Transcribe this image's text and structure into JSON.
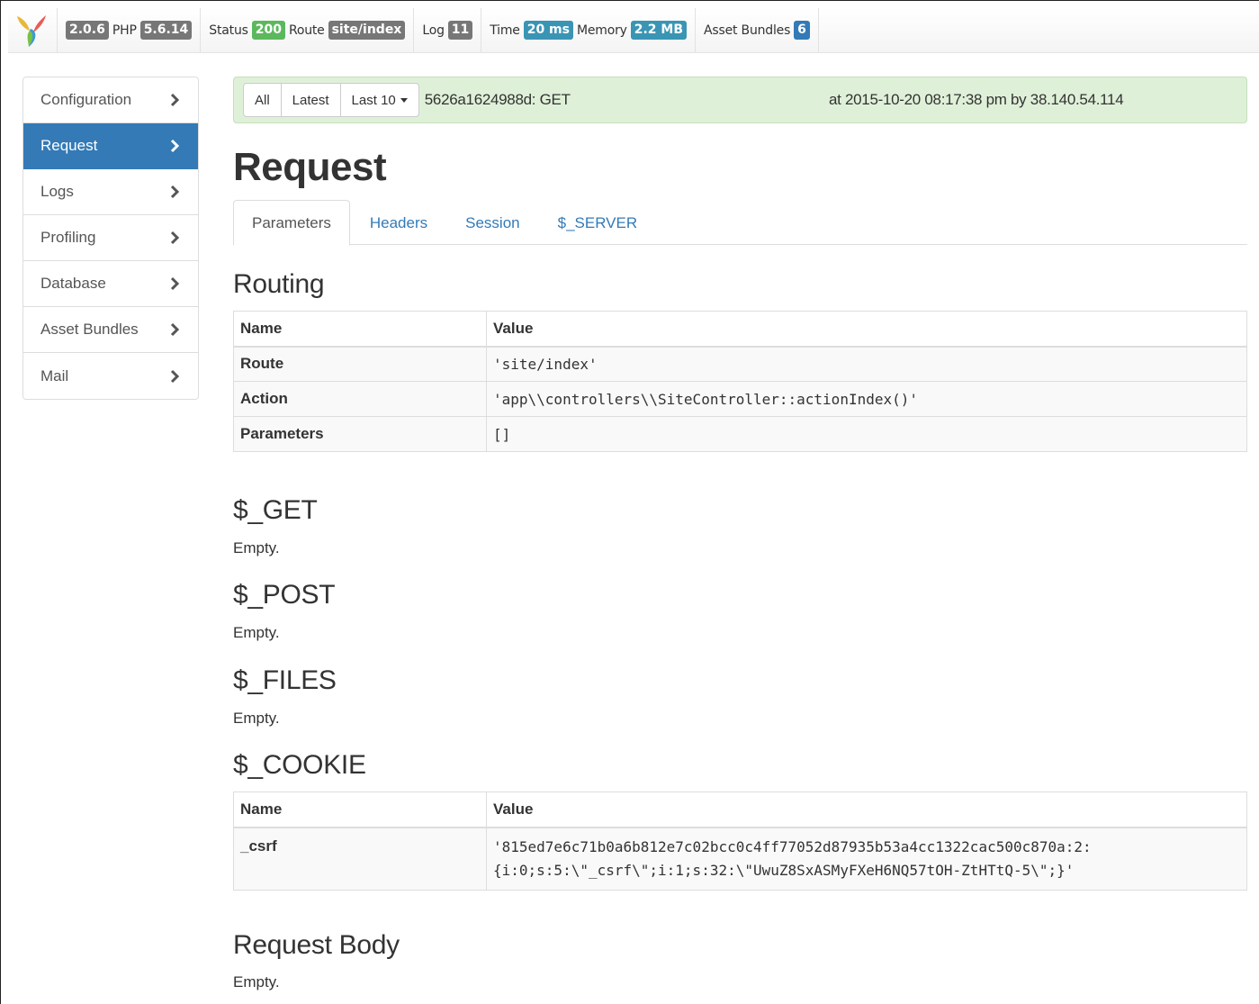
{
  "toolbar": {
    "version": "2.0.6",
    "php_label": "PHP",
    "php_version": "5.6.14",
    "status_label": "Status",
    "status_code": "200",
    "route_label": "Route",
    "route_value": "site/index",
    "log_label": "Log",
    "log_count": "11",
    "time_label": "Time",
    "time_value": "20 ms",
    "memory_label": "Memory",
    "memory_value": "2.2 MB",
    "assets_label": "Asset Bundles",
    "assets_count": "6"
  },
  "sidebar": {
    "items": [
      {
        "label": "Configuration",
        "active": false
      },
      {
        "label": "Request",
        "active": true
      },
      {
        "label": "Logs",
        "active": false
      },
      {
        "label": "Profiling",
        "active": false
      },
      {
        "label": "Database",
        "active": false
      },
      {
        "label": "Asset Bundles",
        "active": false
      },
      {
        "label": "Mail",
        "active": false
      }
    ]
  },
  "request_bar": {
    "all_label": "All",
    "latest_label": "Latest",
    "last10_label": "Last 10",
    "request_id": "5626a1624988d: GET",
    "request_time": "at 2015-10-20 08:17:38 pm by 38.140.54.114"
  },
  "page_title": "Request",
  "tabs": [
    {
      "label": "Parameters",
      "active": true
    },
    {
      "label": "Headers",
      "active": false
    },
    {
      "label": "Session",
      "active": false
    },
    {
      "label": "$_SERVER",
      "active": false
    }
  ],
  "routing": {
    "title": "Routing",
    "header": {
      "name": "Name",
      "value": "Value"
    },
    "rows": [
      {
        "name": "Route",
        "value": "'site/index'"
      },
      {
        "name": "Action",
        "value": "'app\\\\controllers\\\\SiteController::actionIndex()'"
      },
      {
        "name": "Parameters",
        "value": "[]"
      }
    ]
  },
  "get": {
    "title": "$_GET",
    "empty": "Empty."
  },
  "post": {
    "title": "$_POST",
    "empty": "Empty."
  },
  "files": {
    "title": "$_FILES",
    "empty": "Empty."
  },
  "cookie": {
    "title": "$_COOKIE",
    "header": {
      "name": "Name",
      "value": "Value"
    },
    "rows": [
      {
        "name": "_csrf",
        "value_line1": "'815ed7e6c71b0a6b812e7c02bcc0c4ff77052d87935b53a4cc1322cac500c870a:2:",
        "value_line2": "{i:0;s:5:\\\"_csrf\\\";i:1;s:32:\\\"UwuZ8SxASMyFXeH6NQ57tOH-ZtHTtQ-5\\\";}'"
      }
    ]
  },
  "body": {
    "title": "Request Body",
    "empty": "Empty."
  },
  "colors": {
    "accent": "#337ab7",
    "success_bg": "#dff0d8",
    "status_green": "#5cb85c",
    "badge_gray": "#777777"
  },
  "icons": {
    "logo": "yii-logo",
    "chevron": "chevron-right-icon",
    "caret": "caret-down-icon"
  }
}
